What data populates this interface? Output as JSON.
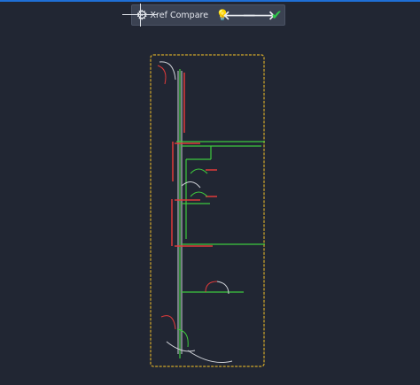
{
  "toolbar": {
    "title": "Xref Compare",
    "settings_icon": "gear-icon",
    "hint_icon": "lightbulb-icon",
    "previous_icon": "arrow-left-icon",
    "next_icon": "arrow-right-icon",
    "accept_icon": "checkmark-icon"
  },
  "colors": {
    "background": "#212633",
    "revision_cloud": "#d4a92a",
    "removed": "#e03a3a",
    "added": "#3ec93e",
    "unchanged": "#cfd2d8"
  }
}
